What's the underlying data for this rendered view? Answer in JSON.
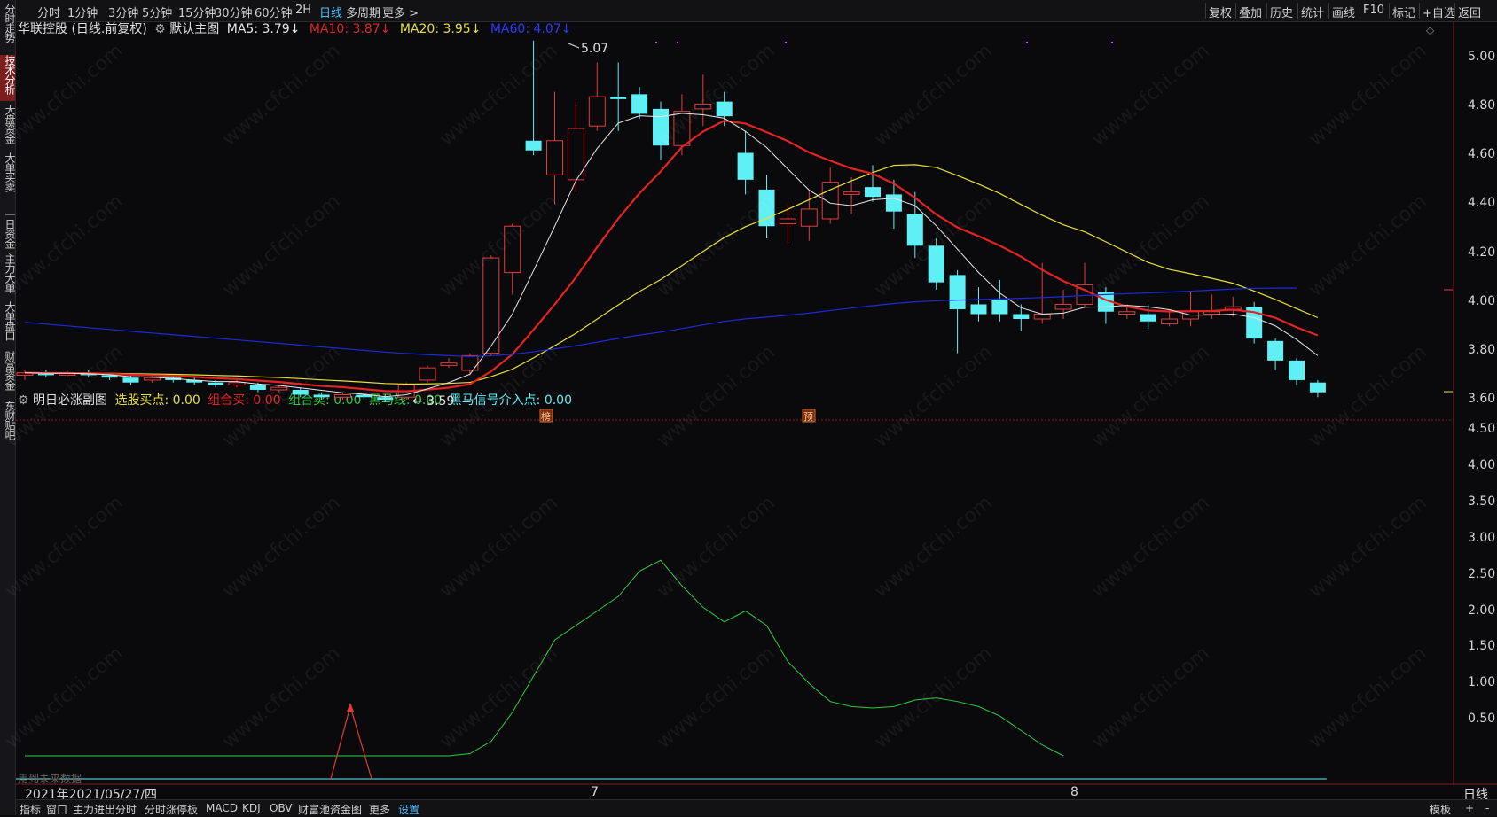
{
  "left_rail": [
    {
      "label": "分时走势",
      "active": false
    },
    {
      "label": "技术分析",
      "active": true
    },
    {
      "label": "大盘资金",
      "active": false
    },
    {
      "label": "大单买卖",
      "active": false
    },
    {
      "label": "一日资金",
      "active": false
    },
    {
      "label": "主力大单",
      "active": false
    },
    {
      "label": "大单盘口",
      "active": false
    },
    {
      "label": "财富资金",
      "active": false
    },
    {
      "label": "东财贴吧",
      "active": false
    }
  ],
  "topbar": {
    "periods": [
      "分时",
      "1分钟",
      "3分钟",
      "5分钟",
      "15分钟",
      "30分钟",
      "60分钟",
      "2H",
      "日线",
      "多周期",
      "更多 >"
    ],
    "active_period": "日线",
    "tools": [
      "复权",
      "叠加",
      "历史",
      "统计",
      "画线",
      "F10",
      "标记",
      "+自选",
      "返回"
    ]
  },
  "main_legend": {
    "title": "华联控股 (日线.前复权)",
    "indicator": "默认主图",
    "ma5": "MA5: 3.79↓",
    "ma10": "MA10: 3.87↓",
    "ma20": "MA20: 3.95↓",
    "ma60": "MA60: 4.07↓"
  },
  "annotations": {
    "high": "5.07",
    "low": "3.59",
    "marker_bang": "榜",
    "marker_yu": "预"
  },
  "price_axis": [
    "5.00",
    "4.80",
    "4.60",
    "4.40",
    "4.20",
    "4.00",
    "3.80",
    "3.60"
  ],
  "sub_legend": {
    "title": "明日必涨副图",
    "xg": "选股买点: 0.00",
    "zhm": "组合买: 0.00",
    "zhs": "组合卖: 0.00",
    "hm": "黑马线: 0.00",
    "hmjr": "黑马信号介入点: 0.00"
  },
  "sub_axis": [
    "4.50",
    "4.00",
    "3.50",
    "3.00",
    "2.50",
    "2.00",
    "1.50",
    "1.00",
    "0.50"
  ],
  "future_note": "用到未来数据",
  "x_axis": {
    "date_cursor": "2021年2021/05/27/四",
    "m7": "7",
    "m8": "8",
    "period_label": "日线"
  },
  "bottom_bar": [
    "指标",
    "窗口",
    "主力进出分时",
    "分时涨停板",
    "MACD",
    "KDJ",
    "OBV",
    "财富池资金图",
    "更多",
    "设置"
  ],
  "bottom_right": [
    "模板",
    "+",
    "-"
  ],
  "watermark": "www.cfchi.com",
  "colors": {
    "up": "#e33b3b",
    "down": "#5ef0f5",
    "ma5": "#e8e8e8",
    "ma10": "#e52222",
    "ma20": "#e8e03a",
    "ma60": "#1e2ad8",
    "sub_line": "#2ecc40"
  },
  "chart_data": {
    "type": "candlestick",
    "ylim": [
      3.55,
      5.07
    ],
    "candles": [
      [
        3.7,
        3.71,
        3.68,
        3.72
      ],
      [
        3.71,
        3.7,
        3.69,
        3.72
      ],
      [
        3.7,
        3.71,
        3.69,
        3.72
      ],
      [
        3.71,
        3.7,
        3.69,
        3.72
      ],
      [
        3.7,
        3.69,
        3.68,
        3.71
      ],
      [
        3.69,
        3.67,
        3.66,
        3.7
      ],
      [
        3.68,
        3.69,
        3.67,
        3.7
      ],
      [
        3.69,
        3.68,
        3.67,
        3.7
      ],
      [
        3.68,
        3.67,
        3.66,
        3.69
      ],
      [
        3.67,
        3.66,
        3.65,
        3.68
      ],
      [
        3.66,
        3.67,
        3.65,
        3.68
      ],
      [
        3.66,
        3.64,
        3.63,
        3.67
      ],
      [
        3.64,
        3.65,
        3.63,
        3.66
      ],
      [
        3.64,
        3.62,
        3.61,
        3.65
      ],
      [
        3.62,
        3.61,
        3.6,
        3.63
      ],
      [
        3.61,
        3.62,
        3.6,
        3.63
      ],
      [
        3.62,
        3.61,
        3.6,
        3.63
      ],
      [
        3.61,
        3.6,
        3.59,
        3.62
      ],
      [
        3.61,
        3.66,
        3.6,
        3.67
      ],
      [
        3.68,
        3.73,
        3.67,
        3.74
      ],
      [
        3.74,
        3.75,
        3.73,
        3.77
      ],
      [
        3.72,
        3.78,
        3.7,
        3.79
      ],
      [
        3.79,
        4.18,
        3.78,
        4.19
      ],
      [
        4.12,
        4.31,
        4.03,
        4.32
      ],
      [
        4.66,
        4.62,
        4.6,
        5.07
      ],
      [
        4.52,
        4.66,
        4.4,
        4.86
      ],
      [
        4.5,
        4.71,
        4.45,
        4.82
      ],
      [
        4.72,
        4.84,
        4.7,
        4.98
      ],
      [
        4.84,
        4.83,
        4.7,
        4.98
      ],
      [
        4.85,
        4.77,
        4.75,
        4.88
      ],
      [
        4.79,
        4.64,
        4.58,
        4.82
      ],
      [
        4.64,
        4.78,
        4.6,
        4.85
      ],
      [
        4.79,
        4.81,
        4.72,
        4.93
      ],
      [
        4.82,
        4.76,
        4.72,
        4.86
      ],
      [
        4.61,
        4.5,
        4.44,
        4.7
      ],
      [
        4.46,
        4.31,
        4.26,
        4.52
      ],
      [
        4.32,
        4.34,
        4.24,
        4.4
      ],
      [
        4.31,
        4.38,
        4.25,
        4.46
      ],
      [
        4.34,
        4.49,
        4.32,
        4.55
      ],
      [
        4.44,
        4.45,
        4.36,
        4.51
      ],
      [
        4.47,
        4.43,
        4.41,
        4.56
      ],
      [
        4.44,
        4.37,
        4.3,
        4.5
      ],
      [
        4.36,
        4.23,
        4.18,
        4.45
      ],
      [
        4.23,
        4.08,
        4.05,
        4.26
      ],
      [
        4.11,
        3.97,
        3.79,
        4.13
      ],
      [
        3.99,
        3.95,
        3.92,
        4.06
      ],
      [
        4.01,
        3.95,
        3.92,
        4.09
      ],
      [
        3.95,
        3.93,
        3.88,
        3.99
      ],
      [
        3.93,
        3.95,
        3.91,
        4.16
      ],
      [
        3.97,
        3.99,
        3.93,
        4.05
      ],
      [
        3.99,
        4.07,
        3.98,
        4.16
      ],
      [
        4.04,
        3.96,
        3.91,
        4.06
      ],
      [
        3.95,
        3.96,
        3.93,
        3.99
      ],
      [
        3.95,
        3.92,
        3.89,
        3.99
      ],
      [
        3.91,
        3.93,
        3.9,
        3.97
      ],
      [
        3.93,
        3.96,
        3.9,
        4.04
      ],
      [
        3.95,
        3.96,
        3.93,
        4.03
      ],
      [
        3.97,
        3.98,
        3.94,
        4.02
      ],
      [
        3.98,
        3.85,
        3.83,
        4.0
      ],
      [
        3.84,
        3.76,
        3.72,
        3.85
      ],
      [
        3.76,
        3.68,
        3.66,
        3.77
      ],
      [
        3.67,
        3.63,
        3.61,
        3.68
      ]
    ],
    "sub_series": [
      0,
      0,
      0,
      0,
      0,
      0,
      0,
      0,
      0,
      0,
      0,
      0,
      0,
      0,
      0,
      0,
      0,
      0,
      0,
      0,
      0,
      0.03,
      0.2,
      0.6,
      1.1,
      1.6,
      1.8,
      2.0,
      2.2,
      2.55,
      2.7,
      2.35,
      2.05,
      1.85,
      2.0,
      1.8,
      1.3,
      1.0,
      0.75,
      0.68,
      0.66,
      0.68,
      0.77,
      0.8,
      0.75,
      0.68,
      0.55,
      0.35,
      0.15,
      0.0
    ],
    "sub_ylim": [
      0,
      4.5
    ]
  }
}
